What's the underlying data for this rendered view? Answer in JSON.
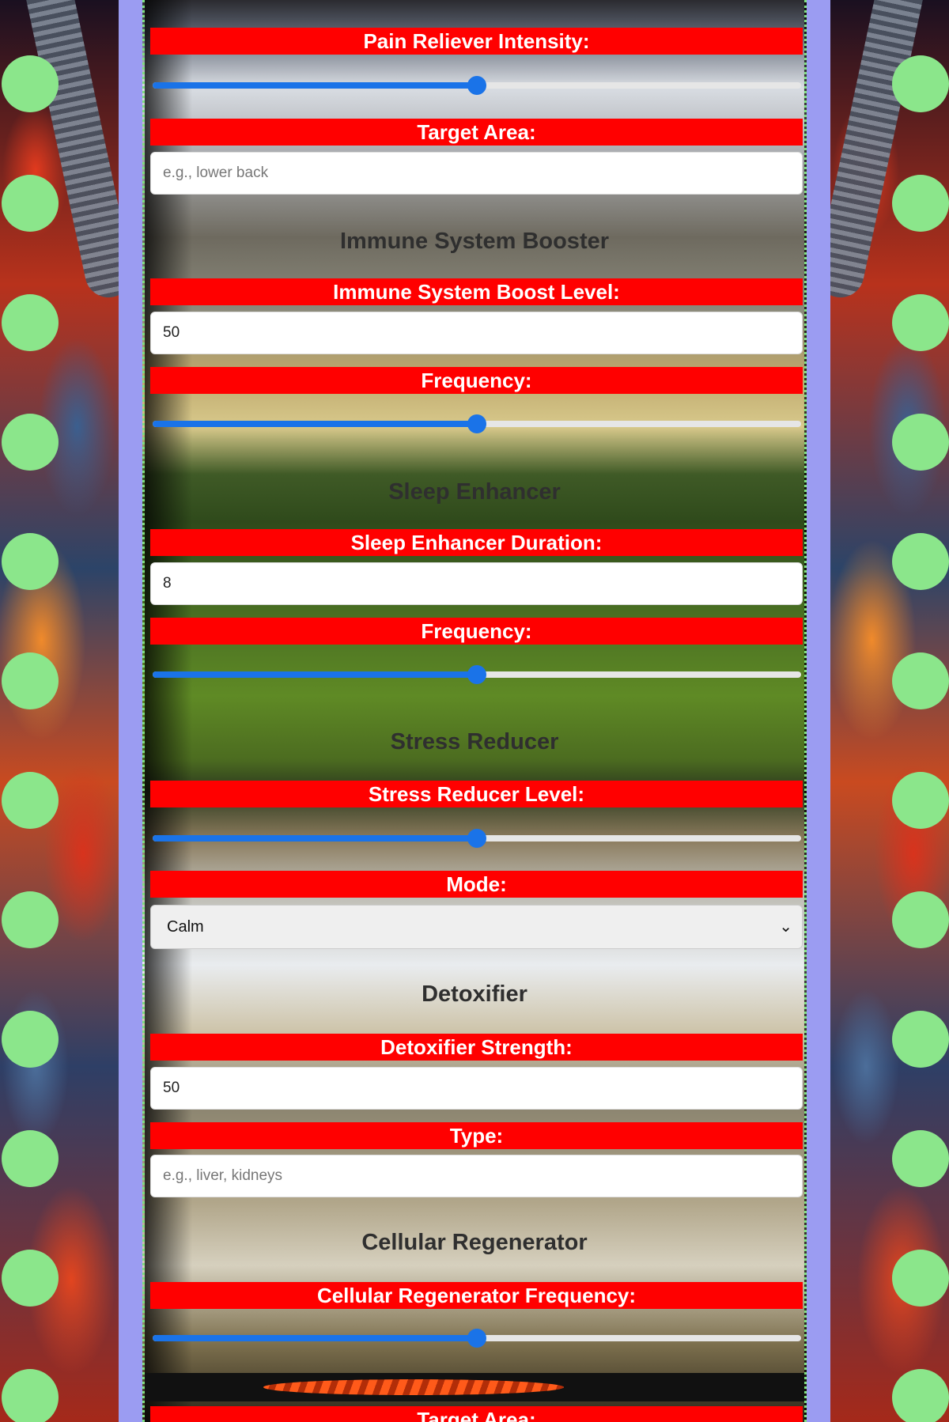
{
  "colors": {
    "label_bg": "#ff0000",
    "label_text": "#ffffff",
    "slider_accent": "#1a73e8",
    "frame": "#9b9cf2",
    "dots": "#8be68b"
  },
  "pain_reliever": {
    "intensity_label": "Pain Reliever Intensity:",
    "intensity_value": 0.5,
    "target_area_label": "Target Area:",
    "target_area_placeholder": "e.g., lower back",
    "target_area_value": ""
  },
  "immune": {
    "title": "Immune System Booster",
    "boost_label": "Immune System Boost Level:",
    "boost_value": "50",
    "frequency_label": "Frequency:",
    "frequency_value": 0.5
  },
  "sleep": {
    "title": "Sleep Enhancer",
    "duration_label": "Sleep Enhancer Duration:",
    "duration_value": "8",
    "frequency_label": "Frequency:",
    "frequency_value": 0.5
  },
  "stress": {
    "title": "Stress Reducer",
    "level_label": "Stress Reducer Level:",
    "level_value": 0.5,
    "mode_label": "Mode:",
    "mode_selected": "Calm"
  },
  "detox": {
    "title": "Detoxifier",
    "strength_label": "Detoxifier Strength:",
    "strength_value": "50",
    "type_label": "Type:",
    "type_placeholder": "e.g., liver, kidneys",
    "type_value": ""
  },
  "cellular": {
    "title": "Cellular Regenerator",
    "frequency_label": "Cellular Regenerator Frequency:",
    "frequency_value": 0.5,
    "target_area_label": "Target Area:"
  }
}
